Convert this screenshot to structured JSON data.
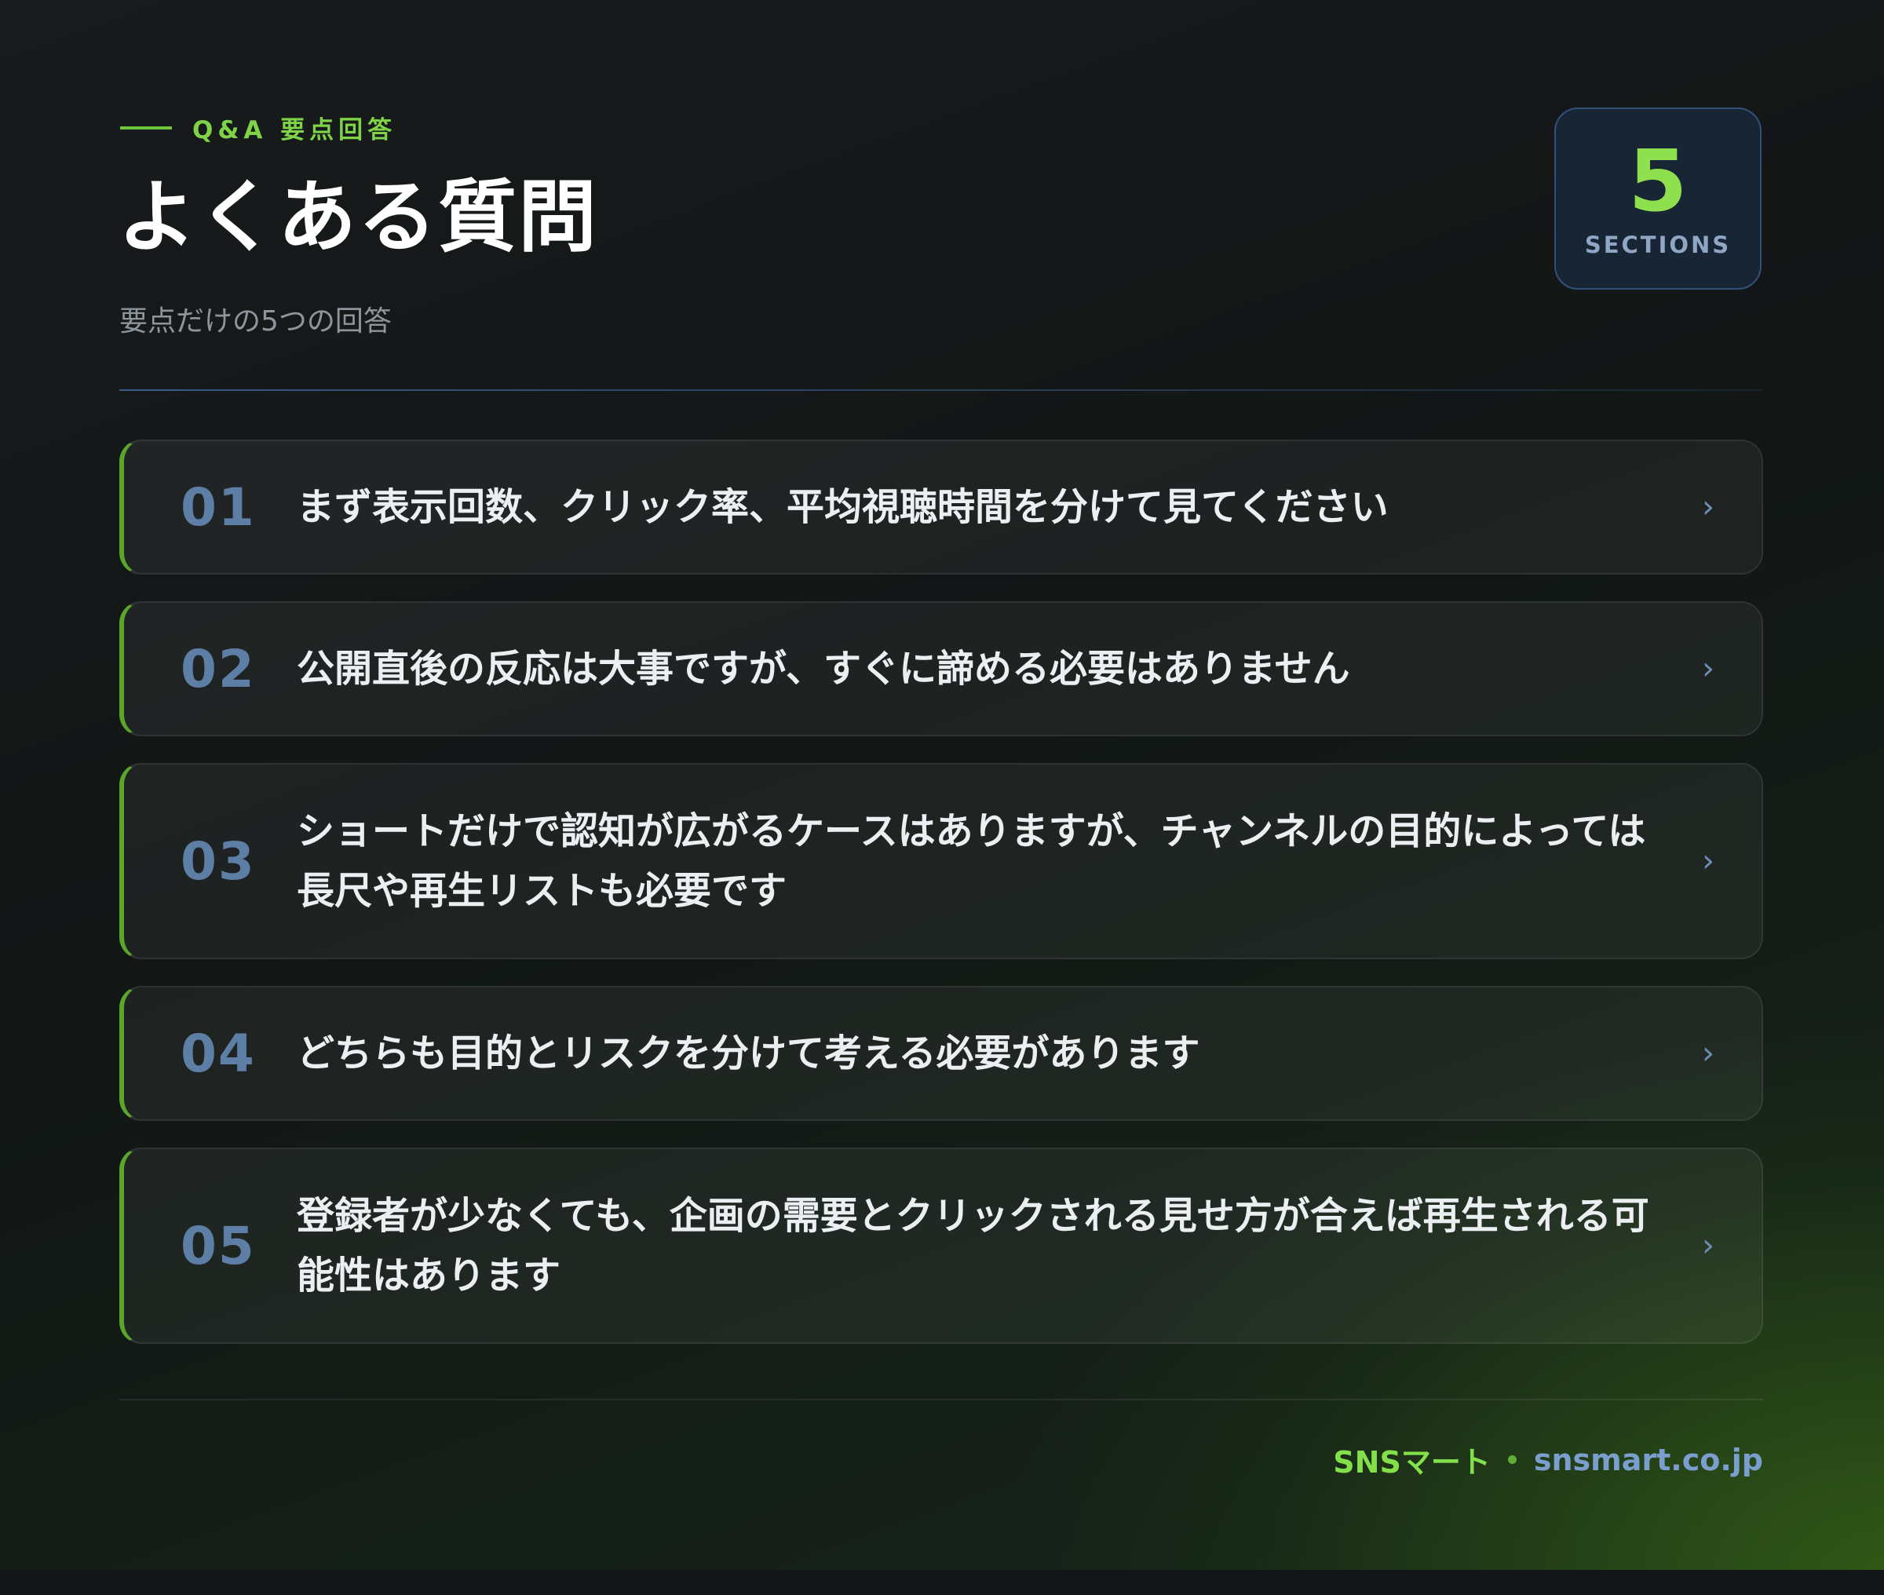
{
  "header": {
    "eyebrow": "Q&A 要点回答",
    "title": "よくある質問",
    "subtitle": "要点だけの5つの回答"
  },
  "badge": {
    "number": "5",
    "label": "SECTIONS"
  },
  "faq": {
    "items": [
      {
        "num": "01",
        "text": "まず表示回数、クリック率、平均視聴時間を分けて見てください"
      },
      {
        "num": "02",
        "text": "公開直後の反応は大事ですが、すぐに諦める必要はありません"
      },
      {
        "num": "03",
        "text": "ショートだけで認知が広がるケースはありますが、チャンネルの目的によっては長尺や再生リストも必要です"
      },
      {
        "num": "04",
        "text": "どちらも目的とリスクを分けて考える必要があります"
      },
      {
        "num": "05",
        "text": "登録者が少なくても、企画の需要とクリックされる見せ方が合えば再生される可能性はあります"
      }
    ],
    "chevron": "›"
  },
  "footer": {
    "brand": "SNSマート",
    "site": "snsmart.co.jp"
  },
  "colors": {
    "accent": "#7fd347",
    "number": "#5d7fa6",
    "background": "#15181b"
  }
}
